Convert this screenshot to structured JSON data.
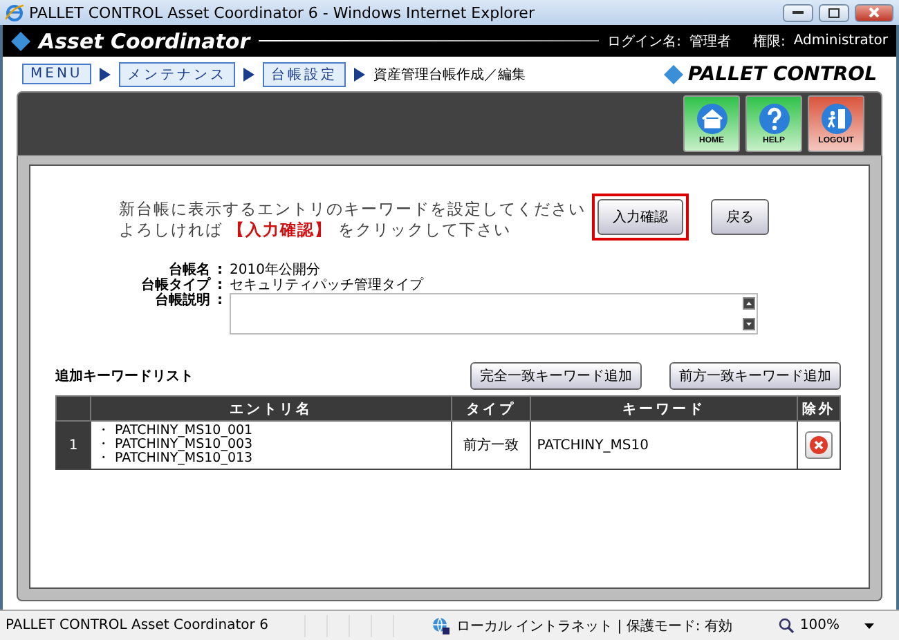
{
  "window": {
    "title": "PALLET CONTROL Asset Coordinator 6 - Windows Internet Explorer"
  },
  "header": {
    "app_name": "Asset Coordinator",
    "login_label": "ログイン名:",
    "login_value": "管理者",
    "role_label": "権限:",
    "role_value": "Administrator"
  },
  "breadcrumbs": [
    {
      "label": "MENU",
      "kind": "link"
    },
    {
      "label": "メンテナンス",
      "kind": "link"
    },
    {
      "label": "台帳設定",
      "kind": "link"
    },
    {
      "label": "資産管理台帳作成／編集",
      "kind": "current"
    }
  ],
  "brand": "PALLET CONTROL",
  "nav_buttons": [
    {
      "label": "HOME",
      "kind": "home"
    },
    {
      "label": "HELP",
      "kind": "help"
    },
    {
      "label": "LOGOUT",
      "kind": "logout"
    }
  ],
  "message": {
    "lines": [
      "新台帳に表示するエントリのキーワードを設定してください",
      "よろしければ **【入力確認】** をクリックして下さい"
    ]
  },
  "actions": [
    {
      "label": "入力確認",
      "focused": true
    },
    {
      "label": "戻る",
      "focused": false
    }
  ],
  "fields": [
    {
      "label": "台帳名",
      "colon": ":",
      "value": "2010年公開分"
    },
    {
      "label": "台帳タイプ",
      "colon": ":",
      "value": "セキュリティパッチ管理タイプ"
    }
  ],
  "description": {
    "label": "台帳説明",
    "colon": ":"
  },
  "keyword_list": {
    "title": "追加キーワードリスト",
    "add_buttons": [
      "完全一致キーワード追加",
      "前方一致キーワード追加"
    ],
    "columns": [
      "エントリ名",
      "タイプ",
      "キーワード",
      "除外"
    ],
    "rows": [
      {
        "index": "1",
        "entries": [
          "・ PATCHINY_MS10_001",
          "・ PATCHINY_MS10_003",
          "・ PATCHINY_MS10_013"
        ],
        "type": "前方一致",
        "keyword": "PATCHINY_MS10"
      }
    ]
  },
  "status_bar": {
    "text": "PALLET CONTROL Asset Coordinator 6",
    "zone": "ローカル イントラネット | 保護モード: 有効",
    "zoom": "100%"
  }
}
